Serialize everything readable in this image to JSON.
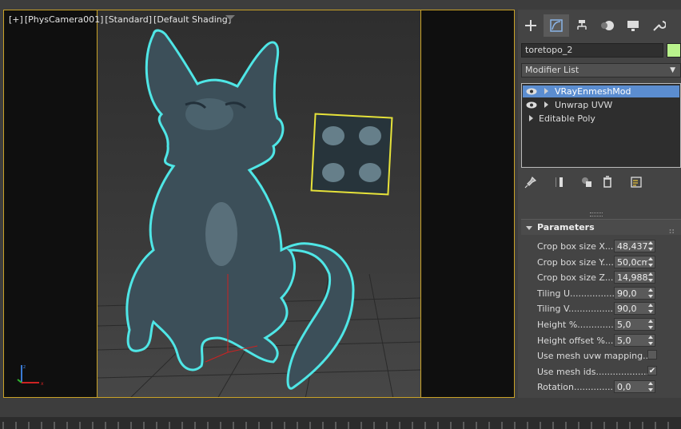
{
  "viewport": {
    "label_plus": "[+]",
    "label_camera": "[PhysCamera001]",
    "label_mode": "[Standard]",
    "label_shading": "[Default Shading]",
    "filter_icon": "funnel-icon"
  },
  "command_panel": {
    "tabs": [
      {
        "name": "create",
        "icon": "plus-icon"
      },
      {
        "name": "modify",
        "icon": "modify-curve-icon"
      },
      {
        "name": "hierarchy",
        "icon": "hierarchy-icon"
      },
      {
        "name": "motion",
        "icon": "motion-icon"
      },
      {
        "name": "display",
        "icon": "display-monitor-icon"
      },
      {
        "name": "utilities",
        "icon": "wrench-icon"
      }
    ],
    "object_name": "toretopo_2",
    "object_color": "#b9f28c",
    "modifier_list_label": "Modifier List",
    "stack": [
      {
        "label": "VRayEnmeshMod",
        "selected": true,
        "has_eye": true
      },
      {
        "label": "Unwrap UVW",
        "selected": false,
        "has_eye": true
      },
      {
        "label": "Editable Poly",
        "selected": false,
        "has_eye": false
      }
    ],
    "stack_tools": [
      "pin-icon",
      "show-end-result-icon",
      "make-unique-icon",
      "remove-modifier-icon",
      "configure-sets-icon"
    ]
  },
  "parameters": {
    "title": "Parameters",
    "rows": [
      {
        "label": "Crop box size X.....",
        "value": "48,4376",
        "type": "spinner"
      },
      {
        "label": "Crop box size Y.....",
        "value": "50,0cm",
        "type": "spinner"
      },
      {
        "label": "Crop box size Z.....",
        "value": "14,9886",
        "type": "spinner"
      },
      {
        "label": "Tiling U................",
        "value": "90,0",
        "type": "spinner"
      },
      {
        "label": "Tiling V................",
        "value": "90,0",
        "type": "spinner"
      },
      {
        "label": "Height %.............",
        "value": "5,0",
        "type": "spinner"
      },
      {
        "label": "Height offset %......",
        "value": "5,0",
        "type": "spinner"
      },
      {
        "label": "Use mesh uvw mapping.....",
        "value": "",
        "type": "checkbox",
        "checked": false
      },
      {
        "label": "Use mesh ids...................",
        "value": "✔",
        "type": "checkbox",
        "checked": true
      },
      {
        "label": "Rotation...............",
        "value": "0,0",
        "type": "spinner"
      }
    ]
  },
  "colors": {
    "selection_outline": "#4fe6e6",
    "viewport_border": "#c9a227",
    "selected_row": "#5b8dd0"
  }
}
